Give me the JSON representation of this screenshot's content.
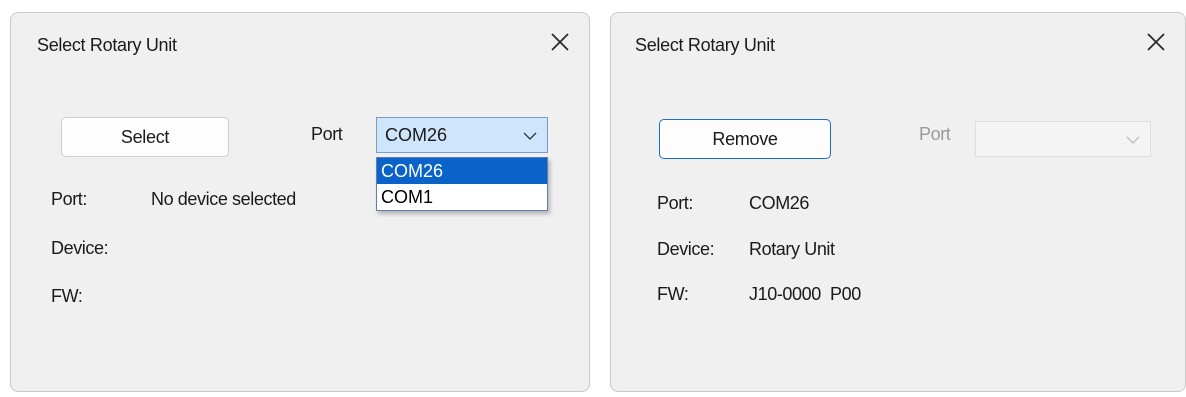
{
  "left_dialog": {
    "title": "Select Rotary Unit",
    "close_glyph": "✕",
    "select_button": "Select",
    "port_combo_label": "Port",
    "port_combo_value": "COM26",
    "dropdown_options": [
      "COM26",
      "COM1"
    ],
    "selected_option": "COM26",
    "info": {
      "port_label": "Port:",
      "port_value": "No device selected",
      "device_label": "Device:",
      "device_value": "",
      "fw_label": "FW:",
      "fw_value": ""
    }
  },
  "right_dialog": {
    "title": "Select Rotary Unit",
    "close_glyph": "✕",
    "remove_button": "Remove",
    "port_combo_label": "Port",
    "port_combo_value": "",
    "port_combo_enabled": false,
    "info": {
      "port_label": "Port:",
      "port_value": "COM26",
      "device_label": "Device:",
      "device_value": "Rotary Unit",
      "fw_label": "FW:",
      "fw_value": "J10-0000  P00"
    }
  },
  "icons": {
    "close": "close-icon",
    "chevron": "chevron-down-icon"
  },
  "colors": {
    "dialog_bg": "#f0f0f0",
    "combo_selected_bg": "#cfe5fb",
    "dropdown_highlight": "#0a63c9",
    "focus_border": "#1f6fc8",
    "disabled_text": "#9a9a9a"
  }
}
